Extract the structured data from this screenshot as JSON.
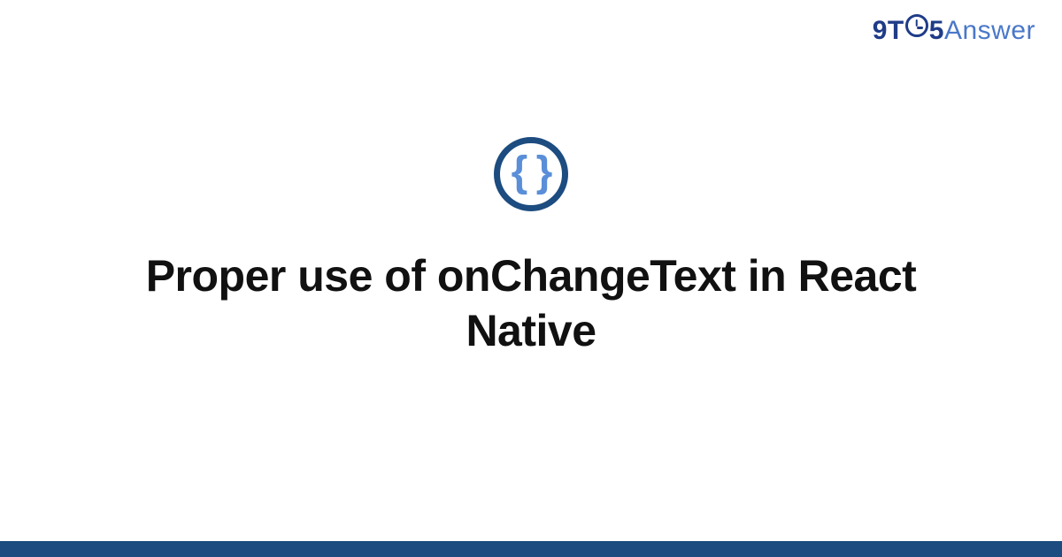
{
  "logo": {
    "part1": "9T",
    "part2": "5",
    "part3": "Answer"
  },
  "badge": {
    "braces": "{ }"
  },
  "title": "Proper use of onChangeText in React Native"
}
